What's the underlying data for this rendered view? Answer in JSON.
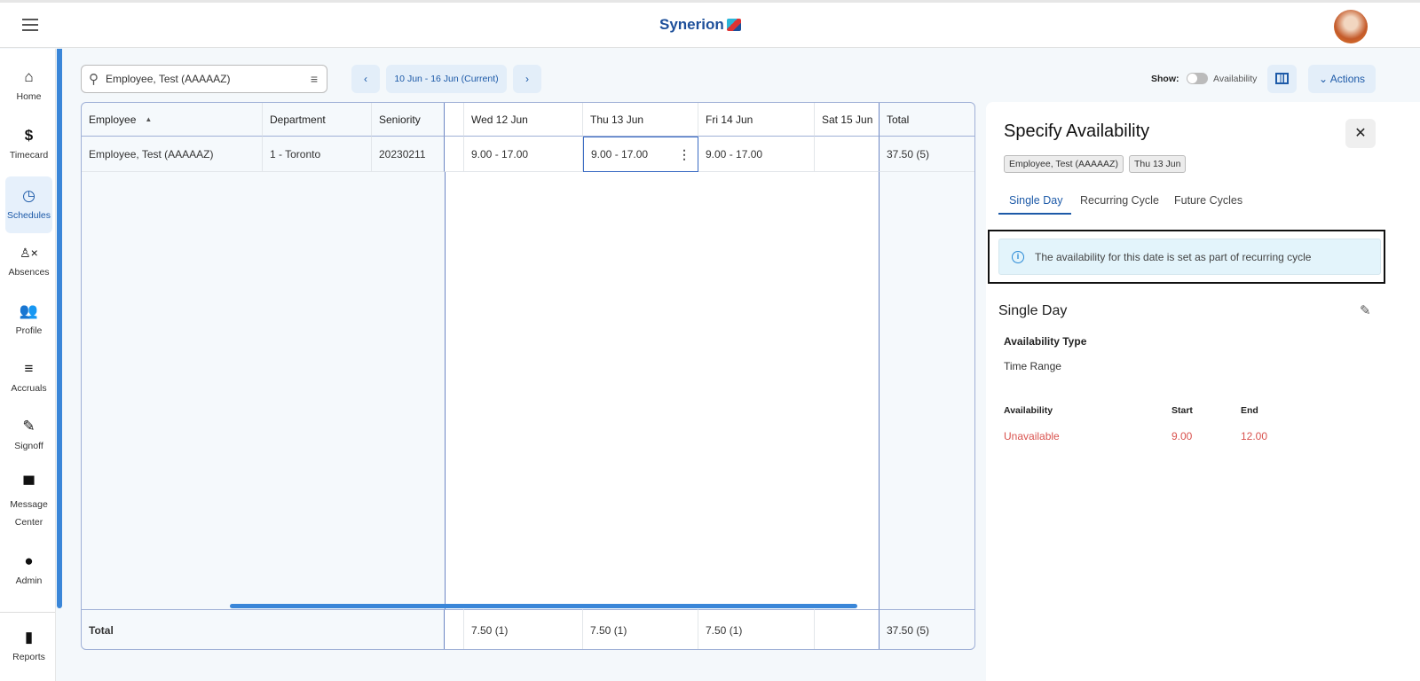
{
  "header": {
    "logo": "Synerion",
    "menu_icon": "hamburger-icon",
    "avatar": "user-avatar"
  },
  "sidebar": {
    "items": [
      {
        "label": "Home",
        "icon": "home-icon"
      },
      {
        "label": "Timecard",
        "icon": "dollar-icon"
      },
      {
        "label": "Schedules",
        "icon": "clock-icon",
        "active": true
      },
      {
        "label": "Absences",
        "icon": "person-x-icon"
      },
      {
        "label": "Profile",
        "icon": "people-icon"
      },
      {
        "label": "Accruals",
        "icon": "accruals-icon"
      },
      {
        "label": "Signoff",
        "icon": "signoff-icon"
      },
      {
        "label": "Message Center",
        "icon": "chat-icon"
      },
      {
        "label": "Admin",
        "icon": "person-icon"
      },
      {
        "label": "Reports",
        "icon": "reports-icon"
      }
    ]
  },
  "toolbar": {
    "search_value": "Employee, Test (AAAAAZ)",
    "date_range": "10 Jun - 16 Jun (Current)",
    "show_label": "Show:",
    "availability_label": "Availability",
    "availability_on": false,
    "actions_label": "Actions"
  },
  "table": {
    "columns": [
      "Employee",
      "Department",
      "Seniority",
      "Wed 12 Jun",
      "Thu 13 Jun",
      "Fri 14 Jun",
      "Sat 15 Jun",
      "Total"
    ],
    "rows": [
      {
        "employee": "Employee, Test (AAAAAZ)",
        "department": "1 - Toronto",
        "seniority": "20230211",
        "wed": "9.00 - 17.00",
        "thu": "9.00 - 17.00",
        "fri": "9.00 - 17.00",
        "sat": "",
        "total": "37.50 (5)"
      }
    ],
    "footer": {
      "label": "Total",
      "wed": "7.50 (1)",
      "thu": "7.50 (1)",
      "fri": "7.50 (1)",
      "sat": "",
      "total": "37.50 (5)"
    }
  },
  "panel": {
    "title": "Specify Availability",
    "chips": [
      "Employee, Test (AAAAAZ)",
      "Thu 13 Jun"
    ],
    "tabs": [
      "Single Day",
      "Recurring Cycle",
      "Future Cycles"
    ],
    "active_tab": "Single Day",
    "info": "The availability for this date is set as part of recurring cycle",
    "section_title": "Single Day",
    "type_label": "Availability Type",
    "type_value": "Time Range",
    "grid_headers": [
      "Availability",
      "Start",
      "End"
    ],
    "grid_row": {
      "availability": "Unavailable",
      "start": "9.00",
      "end": "12.00"
    },
    "colors": {
      "unavailable": "#d9534f",
      "accent": "#1d5aa8"
    }
  }
}
